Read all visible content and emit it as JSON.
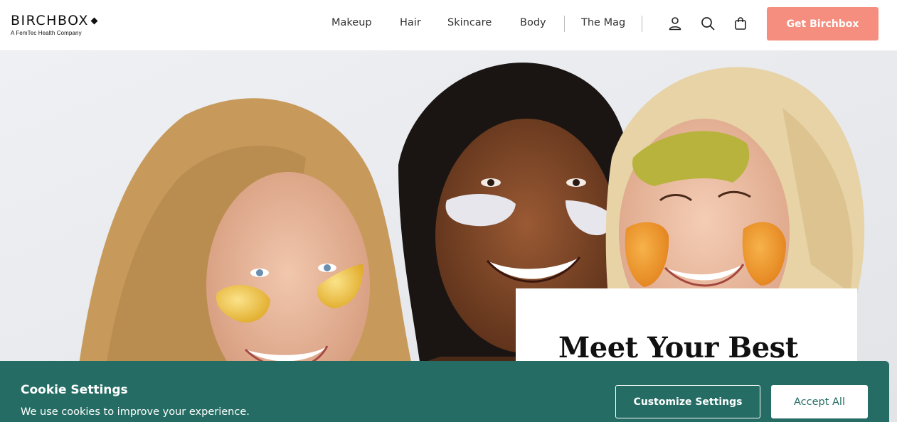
{
  "brand": {
    "name": "BIRCHBOX",
    "tagline": "A FemTec Health Company"
  },
  "nav": {
    "items": [
      {
        "label": "Makeup"
      },
      {
        "label": "Hair"
      },
      {
        "label": "Skincare"
      },
      {
        "label": "Body"
      },
      {
        "label": "The Mag"
      }
    ],
    "icons": [
      "user-icon",
      "search-icon",
      "shopping-bag-icon"
    ],
    "cta_label": "Get Birchbox"
  },
  "hero": {
    "title": "Meet Your Best"
  },
  "cookie": {
    "title": "Cookie Settings",
    "text": "We use cookies to improve your experience.",
    "customize_label": "Customize Settings",
    "accept_label": "Accept All"
  },
  "colors": {
    "cta": "#f58e7e",
    "cookie_bg": "#256d64"
  }
}
